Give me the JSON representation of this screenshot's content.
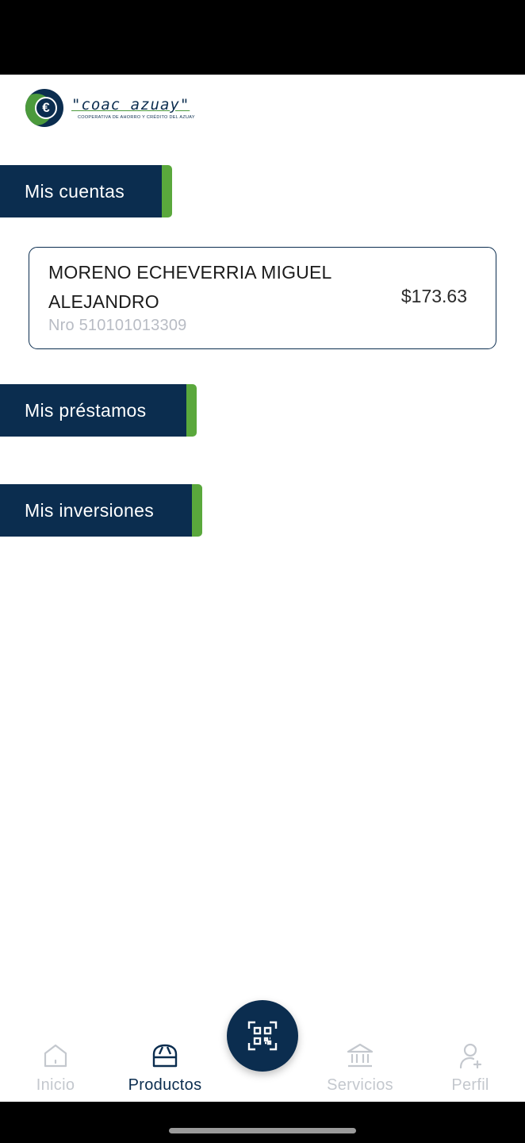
{
  "header": {
    "logo_name": "\"coac azuay\"",
    "logo_subtitle": "COOPERATIVA DE AHORRO Y CRÉDITO DEL AZUAY",
    "logo_symbol": "€"
  },
  "sections": {
    "cuentas": "Mis cuentas",
    "prestamos": "Mis préstamos",
    "inversiones": "Mis inversiones"
  },
  "account": {
    "holder_name": "MORENO ECHEVERRIA MIGUEL ALEJANDRO",
    "number": "Nro 510101013309",
    "balance": "$173.63"
  },
  "bottom_nav": {
    "items": [
      {
        "label": "Inicio",
        "icon": "home-icon",
        "active": false
      },
      {
        "label": "Productos",
        "icon": "products-bag-icon",
        "active": true
      },
      {
        "label": "Servicios",
        "icon": "bank-icon",
        "active": false
      },
      {
        "label": "Perfil",
        "icon": "user-add-icon",
        "active": false
      }
    ],
    "fab_icon": "qr-code-icon"
  },
  "colors": {
    "primary": "#0b2d4f",
    "accent": "#5aa83c",
    "inactive": "#c4c8ce",
    "muted_text": "#b8bcc4"
  }
}
